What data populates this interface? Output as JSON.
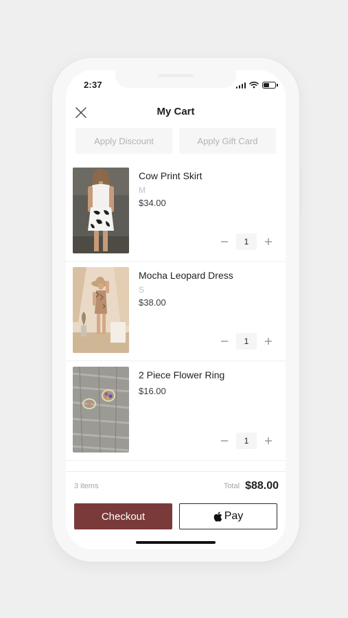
{
  "status_bar": {
    "time": "2:37",
    "battery_percent": 50
  },
  "header": {
    "title": "My Cart",
    "close_icon": "close-icon"
  },
  "promo": {
    "discount_label": "Apply Discount",
    "gift_card_label": "Apply Gift Card"
  },
  "cart_items": [
    {
      "name": "Cow Print Skirt",
      "size": "M",
      "price": "$34.00",
      "quantity": "1",
      "image": "model-in-cow-print-skirt"
    },
    {
      "name": "Mocha Leopard Dress",
      "size": "S",
      "price": "$38.00",
      "quantity": "1",
      "image": "model-in-leopard-dress"
    },
    {
      "name": "2 Piece Flower Ring",
      "size": "",
      "price": "$16.00",
      "quantity": "1",
      "image": "flower-rings-on-wood"
    }
  ],
  "summary": {
    "item_count": "3 items",
    "total_label": "Total",
    "total_value": "$88.00"
  },
  "actions": {
    "checkout_label": "Checkout",
    "apple_pay_label": "Pay"
  },
  "colors": {
    "checkout": "#7a3a3a",
    "background": "#efefef"
  }
}
